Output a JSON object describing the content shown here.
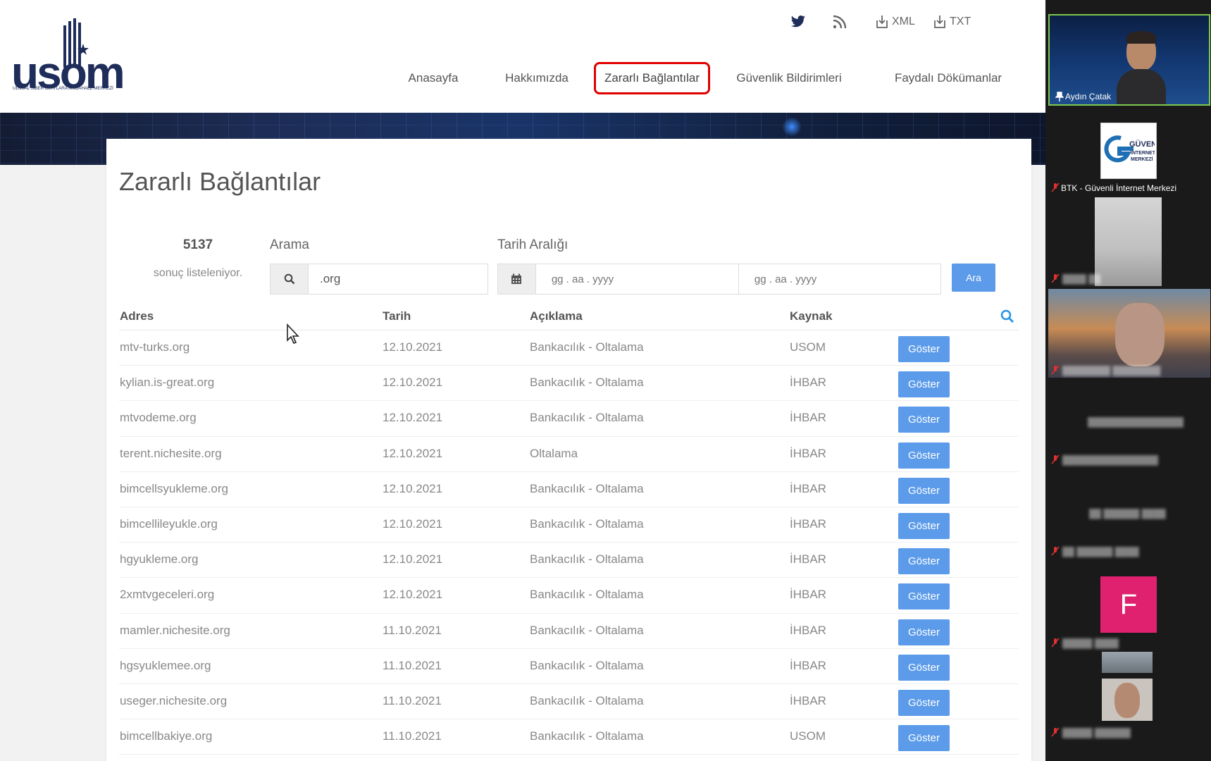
{
  "site": {
    "logo_text": "usom",
    "logo_subtitle": "ULUSAL SİBER OLAYLARA MÜDAHALE MERKEZİ",
    "top_links": [
      {
        "name": "twitter",
        "label": ""
      },
      {
        "name": "rss",
        "label": ""
      },
      {
        "name": "xml",
        "label": "XML"
      },
      {
        "name": "txt",
        "label": "TXT"
      }
    ],
    "nav": [
      {
        "label": "Anasayfa"
      },
      {
        "label": "Hakkımızda"
      },
      {
        "label": "Zararlı Bağlantılar",
        "active": true
      },
      {
        "label": "Güvenlik Bildirimleri"
      },
      {
        "label": "Faydalı Dökümanlar"
      }
    ]
  },
  "page": {
    "title": "Zararlı Bağlantılar",
    "result_count": "5137",
    "result_text": "sonuç listeleniyor.",
    "search": {
      "label": "Arama",
      "value": ".org"
    },
    "date_range": {
      "label": "Tarih Aralığı",
      "from_placeholder": "gg . aa . yyyy",
      "to_placeholder": "gg . aa . yyyy"
    },
    "search_button": "Ara"
  },
  "table": {
    "headers": [
      "Adres",
      "Tarih",
      "Açıklama",
      "Kaynak"
    ],
    "button_label": "Göster",
    "rows": [
      [
        "mtv-turks.org",
        "12.10.2021",
        "Bankacılık - Oltalama",
        "USOM"
      ],
      [
        "kylian.is-great.org",
        "12.10.2021",
        "Bankacılık - Oltalama",
        "İHBAR"
      ],
      [
        "mtvodeme.org",
        "12.10.2021",
        "Bankacılık - Oltalama",
        "İHBAR"
      ],
      [
        "terent.nichesite.org",
        "12.10.2021",
        "Oltalama",
        "İHBAR"
      ],
      [
        "bimcellsyukleme.org",
        "12.10.2021",
        "Bankacılık - Oltalama",
        "İHBAR"
      ],
      [
        "bimcellileyukle.org",
        "12.10.2021",
        "Bankacılık - Oltalama",
        "İHBAR"
      ],
      [
        "hgyukleme.org",
        "12.10.2021",
        "Bankacılık - Oltalama",
        "İHBAR"
      ],
      [
        "2xmtvgeceleri.org",
        "12.10.2021",
        "Bankacılık - Oltalama",
        "İHBAR"
      ],
      [
        "mamler.nichesite.org",
        "11.10.2021",
        "Bankacılık - Oltalama",
        "İHBAR"
      ],
      [
        "hgsyuklemee.org",
        "11.10.2021",
        "Bankacılık - Oltalama",
        "İHBAR"
      ],
      [
        "useger.nichesite.org",
        "11.10.2021",
        "Bankacılık - Oltalama",
        "İHBAR"
      ],
      [
        "bimcellbakiye.org",
        "11.10.2021",
        "Bankacılık - Oltalama",
        "USOM"
      ]
    ]
  },
  "call": {
    "participants": [
      {
        "name": "Aydın Çatak"
      },
      {
        "name": "BTK - Güvenli İnternet Merkezi",
        "logo_text": "GÜVENLİ İNTERNET MERKEZİ"
      },
      {
        "name": "F",
        "initial": "F"
      }
    ]
  },
  "colors": {
    "accent": "#5b9bea",
    "active_nav_border": "#e00000",
    "logo_blue": "#1f2d5a",
    "avatar_pink": "#e0216f",
    "speaker_border": "#7ec84e"
  }
}
